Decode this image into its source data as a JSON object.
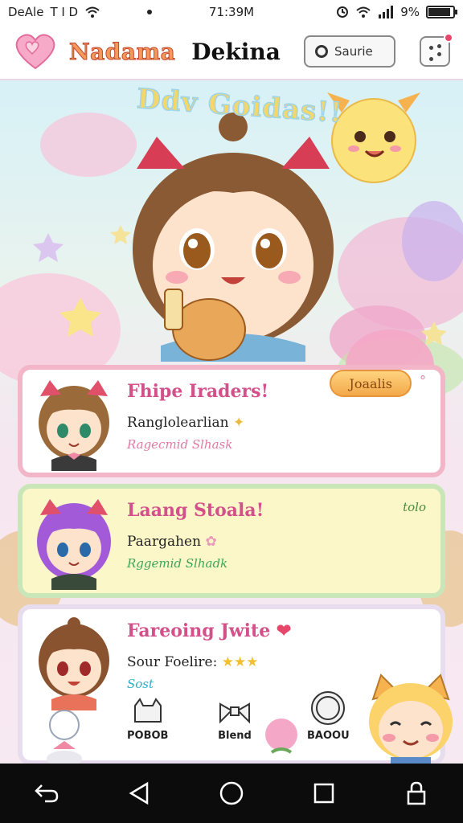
{
  "status_bar": {
    "carrier": "DeAle",
    "carrier_suffix": "T I D",
    "time": "71:39M",
    "battery_text": "9%",
    "battery_level": 0.9
  },
  "header": {
    "logo_icon": "heart-icon",
    "brand_primary": "Nadama",
    "brand_secondary": "Dekina",
    "search_label": "Saurie",
    "dice_icon": "dice-icon"
  },
  "hero": {
    "title": "Ddv Goidas!!"
  },
  "cards": [
    {
      "title": "Fhipe Iraders!",
      "line": "Ranglolearlian",
      "sub": "Ragecmid Slhask",
      "button": "Joaalis",
      "button_suffix": "°"
    },
    {
      "title": "Laang Stoala!",
      "line": "Paargahen",
      "sub": "Rggemid Slhadk",
      "tag": "tolo"
    },
    {
      "title": "Fareoing Jwite",
      "line": "Sour Foelire:",
      "stars": 3,
      "sub": "Sost"
    }
  ],
  "dock": [
    {
      "label": "POBOB",
      "icon": "cat-stamp-icon"
    },
    {
      "label": "Blend",
      "icon": "ribbon-icon"
    },
    {
      "label": "BAOOU",
      "icon": "coin-icon"
    }
  ],
  "colors": {
    "accent_pink": "#d3518a",
    "card1_border": "#f3b5c8",
    "card2_bg": "#fbf7c9",
    "button_orange": "#f3a94a"
  }
}
